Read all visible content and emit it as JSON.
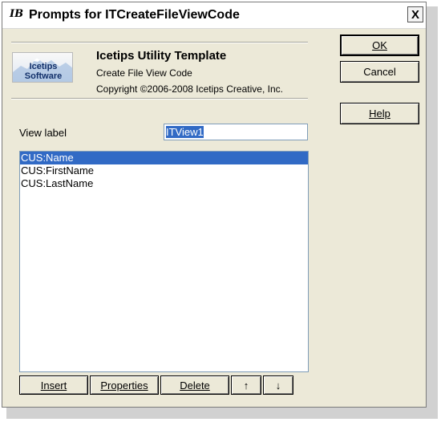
{
  "window": {
    "title": "Prompts for ITCreateFileViewCode",
    "close_symbol": "X",
    "app_icon": "IB"
  },
  "header": {
    "logo": {
      "icon": "icetips-software-logo",
      "line1": "Icetips",
      "line2": "Software"
    },
    "title": "Icetips Utility Template",
    "subtitle": "Create File View Code",
    "copyright": "Copyright ©2006-2008 Icetips Creative, Inc."
  },
  "buttons": {
    "ok": "OK",
    "cancel": "Cancel",
    "help": "Help"
  },
  "form": {
    "view_label": "View label",
    "view_value": "ITView1"
  },
  "list": {
    "items": [
      "CUS:Name",
      "CUS:FirstName",
      "CUS:LastName"
    ],
    "selected_index": 0
  },
  "list_buttons": {
    "insert": "Insert",
    "properties": "Properties",
    "delete": "Delete",
    "up": "↑",
    "down": "↓"
  },
  "colors": {
    "selection": "#316ac5",
    "dialog_bg": "#ece9d8"
  }
}
